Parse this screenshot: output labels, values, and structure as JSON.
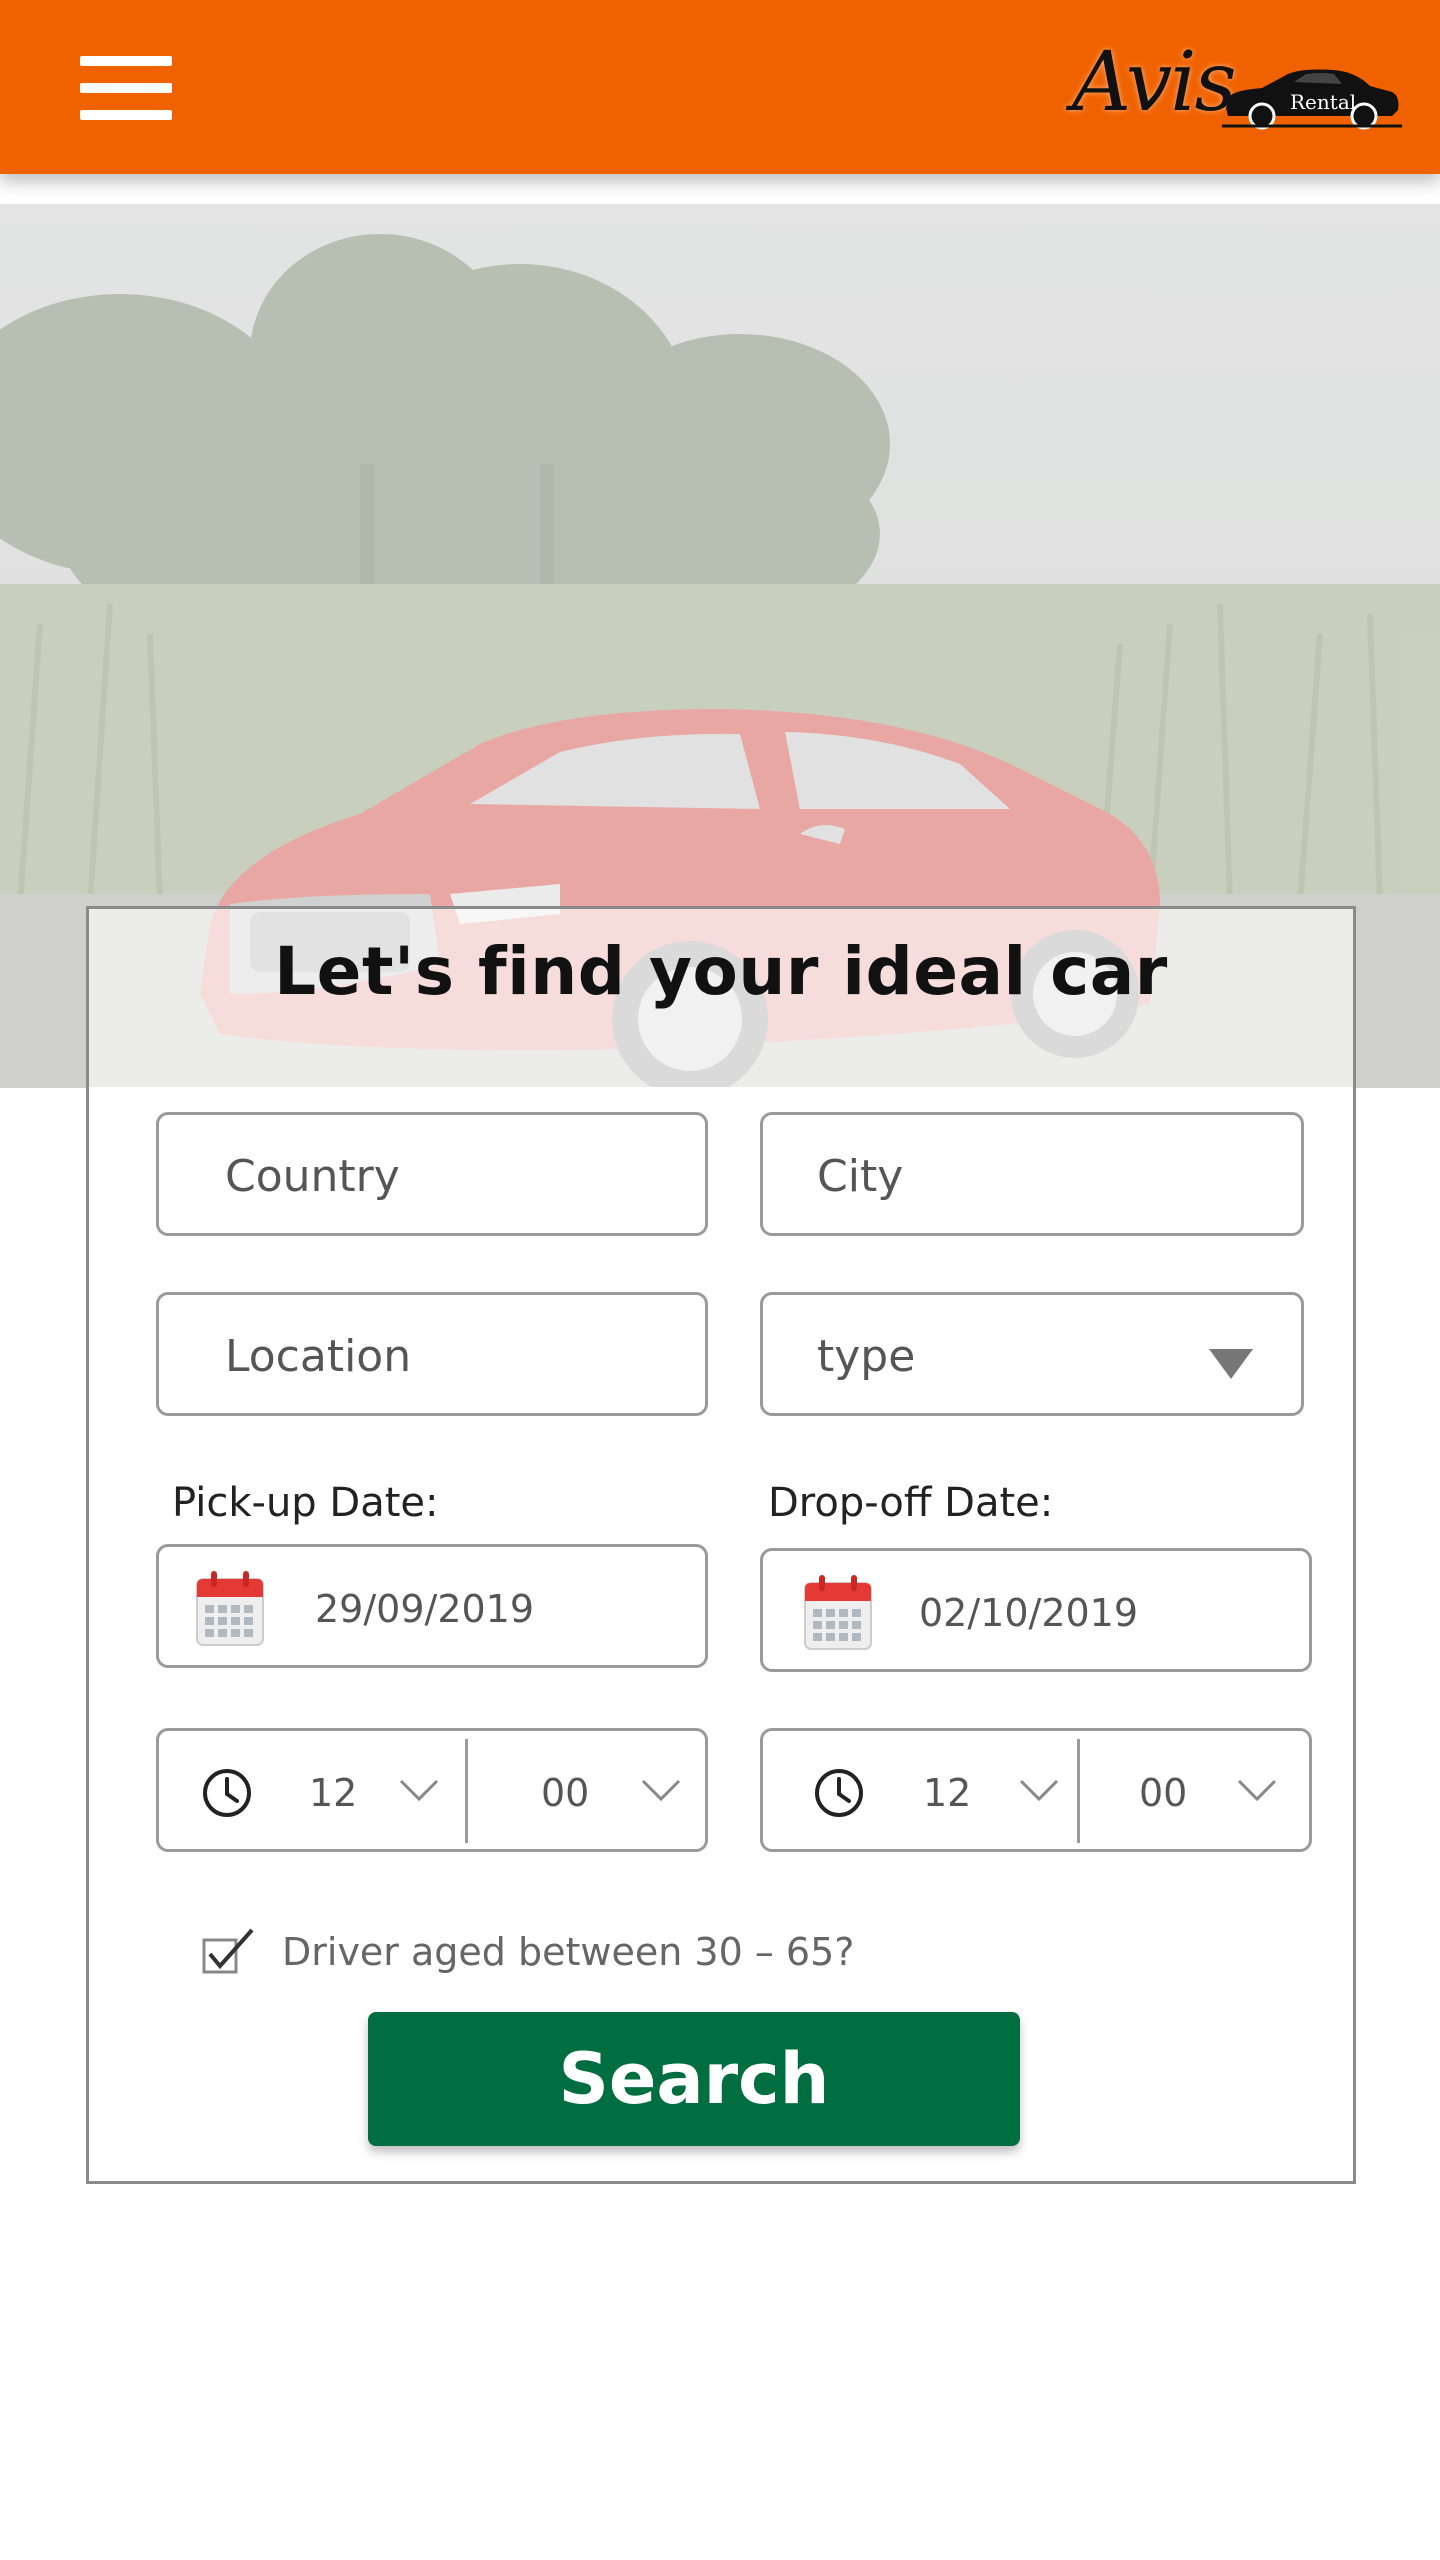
{
  "header": {
    "menu_icon": "hamburger-menu-icon",
    "logo_text": "Avis",
    "logo_sub": "Rental",
    "background_color": "#f06200"
  },
  "hero": {
    "image": "red sedan parked in front of a cornfield and trees"
  },
  "form": {
    "title": "Let's find your ideal car",
    "country_placeholder": "Country",
    "city_placeholder": "City",
    "location_placeholder": "Location",
    "type_placeholder": "type",
    "pickup_label": "Pick-up Date:",
    "dropoff_label": "Drop-off Date:",
    "pickup_date": "29/09/2019",
    "dropoff_date": "02/10/2019",
    "pickup_hour": "12",
    "pickup_minute": "00",
    "dropoff_hour": "12",
    "dropoff_minute": "00",
    "driver_age_label": "Driver aged between 30 – 65?",
    "driver_age_checked": true,
    "search_label": "Search",
    "search_color": "#006e40"
  }
}
